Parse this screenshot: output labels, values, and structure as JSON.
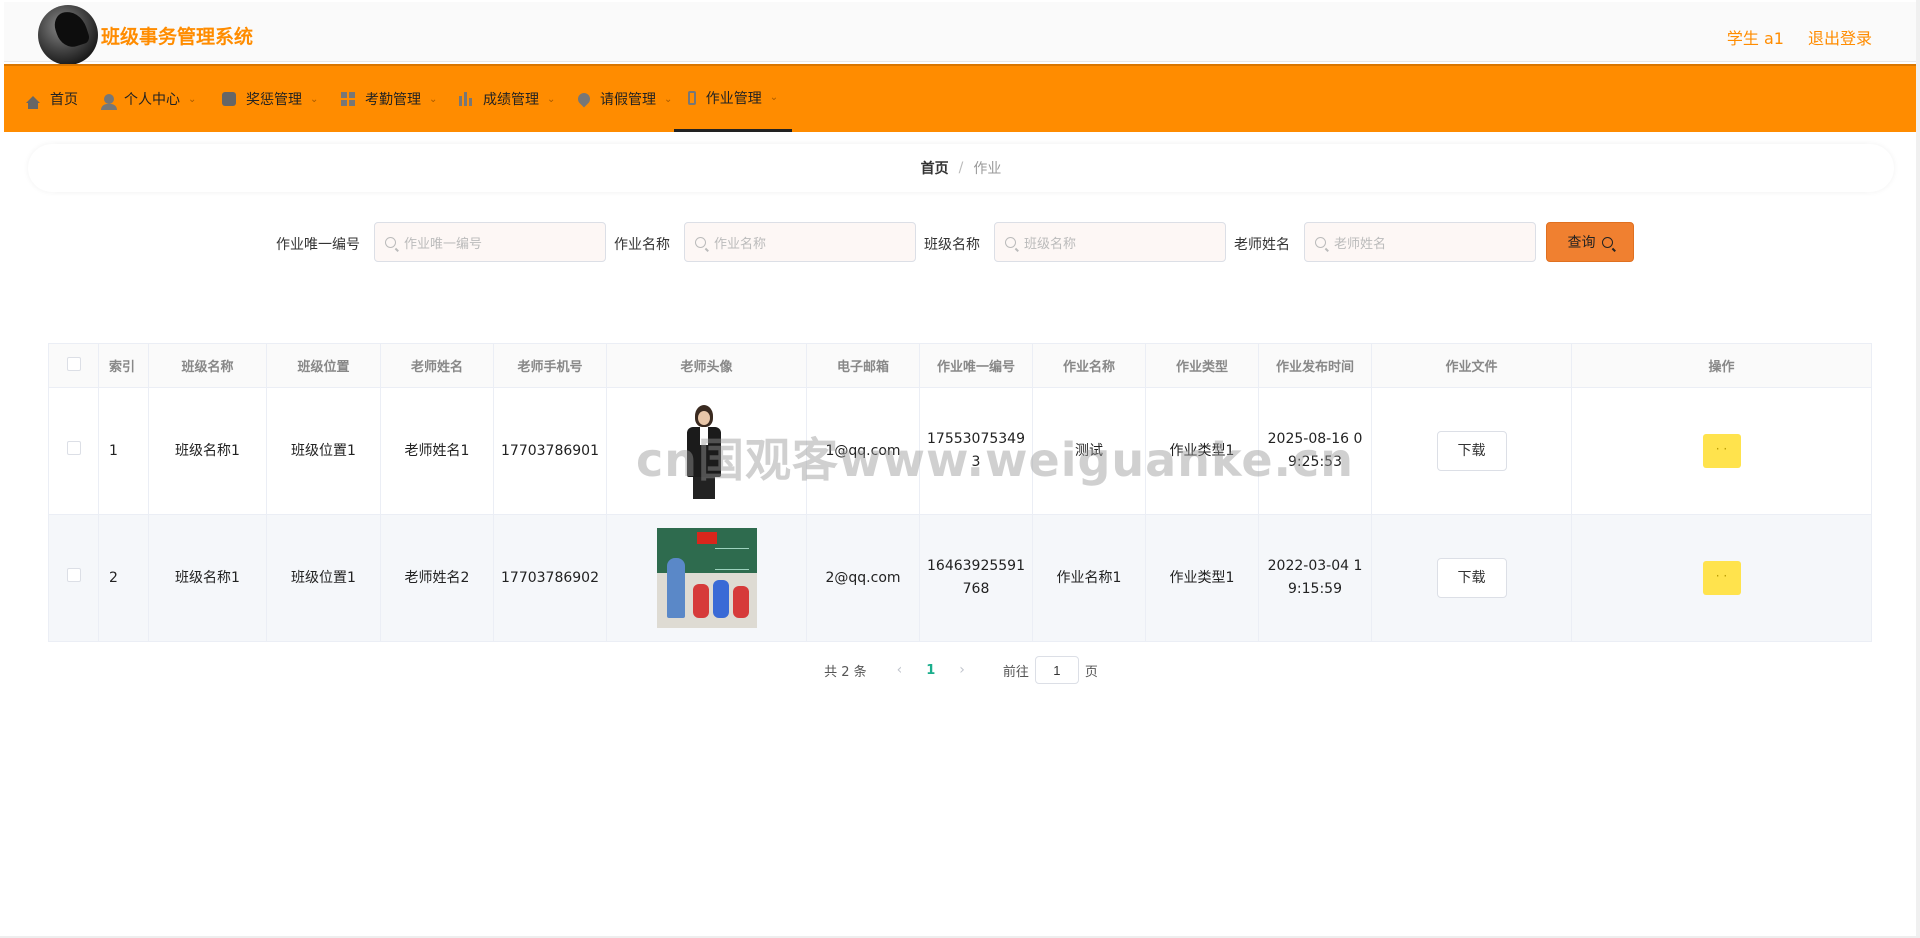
{
  "header": {
    "app_title": "班级事务管理系统",
    "user_label": "学生 a1",
    "logout_label": "退出登录"
  },
  "nav": {
    "items": [
      {
        "label": "首页",
        "icon": "home-icon"
      },
      {
        "label": "个人中心",
        "icon": "user-icon"
      },
      {
        "label": "奖惩管理",
        "icon": "message-icon"
      },
      {
        "label": "考勤管理",
        "icon": "grid-icon"
      },
      {
        "label": "成绩管理",
        "icon": "bar-chart-icon"
      },
      {
        "label": "请假管理",
        "icon": "location-icon"
      },
      {
        "label": "作业管理",
        "icon": "phone-icon"
      }
    ],
    "active_index": 6
  },
  "breadcrumb": {
    "home": "首页",
    "separator": "/",
    "current": "作业"
  },
  "search": {
    "fields": [
      {
        "label": "作业唯一编号",
        "placeholder": "作业唯一编号"
      },
      {
        "label": "作业名称",
        "placeholder": "作业名称"
      },
      {
        "label": "班级名称",
        "placeholder": "班级名称"
      },
      {
        "label": "老师姓名",
        "placeholder": "老师姓名"
      }
    ],
    "button_label": "查询"
  },
  "table": {
    "columns": [
      "索引",
      "班级名称",
      "班级位置",
      "老师姓名",
      "老师手机号",
      "老师头像",
      "电子邮箱",
      "作业唯一编号",
      "作业名称",
      "作业类型",
      "作业发布时间",
      "作业文件",
      "操作"
    ],
    "rows": [
      {
        "index": "1",
        "class_name": "班级名称1",
        "class_location": "班级位置1",
        "teacher_name": "老师姓名1",
        "teacher_phone": "17703786901",
        "email": "1@qq.com",
        "hw_id": "175530753493",
        "hw_name": "测试",
        "hw_type": "作业类型1",
        "publish_time": "2025-08-16 09:25:53",
        "download_label": "下载",
        "action_label": "· ·"
      },
      {
        "index": "2",
        "class_name": "班级名称1",
        "class_location": "班级位置1",
        "teacher_name": "老师姓名2",
        "teacher_phone": "17703786902",
        "email": "2@qq.com",
        "hw_id": "16463925591768",
        "hw_name": "作业名称1",
        "hw_type": "作业类型1",
        "publish_time": "2022-03-04 19:15:59",
        "download_label": "下载",
        "action_label": "· ·"
      }
    ]
  },
  "pagination": {
    "total_text": "共 2 条",
    "prev": "‹",
    "current_page": "1",
    "next": "›",
    "goto_prefix": "前往",
    "goto_value": "1",
    "goto_suffix": "页"
  },
  "watermark": "cn国观客www.weiguanke.cn",
  "colors": {
    "brand": "#ff8c00",
    "search_button": "#f08030",
    "action_button": "#ffe34d",
    "active_page": "#1aae8c"
  }
}
